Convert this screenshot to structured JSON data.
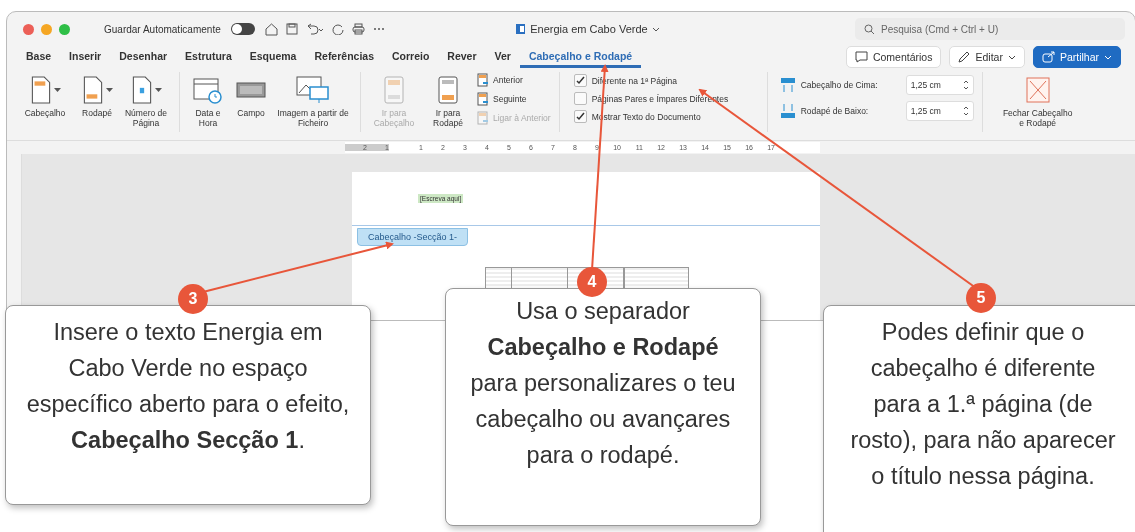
{
  "window": {
    "autosave_label": "Guardar Automaticamente",
    "autosave_on": false,
    "title": "Energia em Cabo Verde",
    "search_placeholder": "Pesquisa (Cmd + Ctrl + U)"
  },
  "tabs": [
    {
      "label": "Base",
      "selected": false
    },
    {
      "label": "Inserir",
      "selected": false
    },
    {
      "label": "Desenhar",
      "selected": false
    },
    {
      "label": "Estrutura",
      "selected": false
    },
    {
      "label": "Esquema",
      "selected": false
    },
    {
      "label": "Referências",
      "selected": false
    },
    {
      "label": "Correio",
      "selected": false
    },
    {
      "label": "Rever",
      "selected": false
    },
    {
      "label": "Ver",
      "selected": false
    },
    {
      "label": "Cabeçalho e Rodapé",
      "selected": true
    }
  ],
  "actions": [
    {
      "label": "Comentários",
      "kind": "comments"
    },
    {
      "label": "Editar",
      "kind": "edit"
    },
    {
      "label": "Partilhar",
      "kind": "share"
    }
  ],
  "ribbon": {
    "insert_buttons": [
      {
        "label": "Cabeçalho",
        "kind": "header"
      },
      {
        "label": "Rodapé",
        "kind": "footer"
      },
      {
        "label": "Número de Página",
        "kind": "page-number"
      }
    ],
    "field_buttons": [
      {
        "label": "Data e Hora",
        "kind": "date"
      },
      {
        "label": "Campo",
        "kind": "field"
      },
      {
        "label": "Imagem a partir de Ficheiro",
        "kind": "image"
      }
    ],
    "nav_buttons": [
      {
        "label": "Ir para Cabeçalho",
        "disabled": true
      },
      {
        "label": "Ir para Rodapé",
        "disabled": false
      }
    ],
    "nav_links": [
      {
        "label": "Anterior",
        "disabled": false
      },
      {
        "label": "Seguinte",
        "disabled": false
      },
      {
        "label": "Ligar à Anterior",
        "disabled": true
      }
    ],
    "options": [
      {
        "label": "Diferente na 1ª Página",
        "checked": true
      },
      {
        "label": "Páginas Pares e Ímpares Diferentes",
        "checked": false
      },
      {
        "label": "Mostrar Texto do Documento",
        "checked": true
      }
    ],
    "positions": [
      {
        "label": "Cabeçalho de Cima:",
        "value": "1,25 cm",
        "kind": "top"
      },
      {
        "label": "Rodapé de Baixo:",
        "value": "1,25 cm",
        "kind": "bottom"
      }
    ],
    "close_button": {
      "label": "Fechar Cabeçalho e Rodapé"
    }
  },
  "ruler": {
    "left_marks": [
      "2",
      "1"
    ],
    "right_marks": [
      "1",
      "2",
      "3",
      "4",
      "5",
      "6",
      "7",
      "8",
      "9",
      "10",
      "11",
      "12",
      "13",
      "14",
      "15",
      "16",
      "17"
    ]
  },
  "document": {
    "header_placeholder": "[Escreva aqui]",
    "header_label": "Cabeçalho -Secção 1-"
  },
  "callouts": [
    {
      "number": "3",
      "text": "Insere o texto Energia em Cabo Verde no espaço específico aberto para o efeito, **Cabeçalho Secção 1**."
    },
    {
      "number": "4",
      "text": "Usa o separador **Cabeçalho e Rodapé** para personalizares o teu cabeçalho ou avançares para o rodapé."
    },
    {
      "number": "5",
      "text": "Podes definir que o cabeçalho é diferente para a 1.ª página (de rosto), para não aparecer o título nessa página."
    }
  ]
}
